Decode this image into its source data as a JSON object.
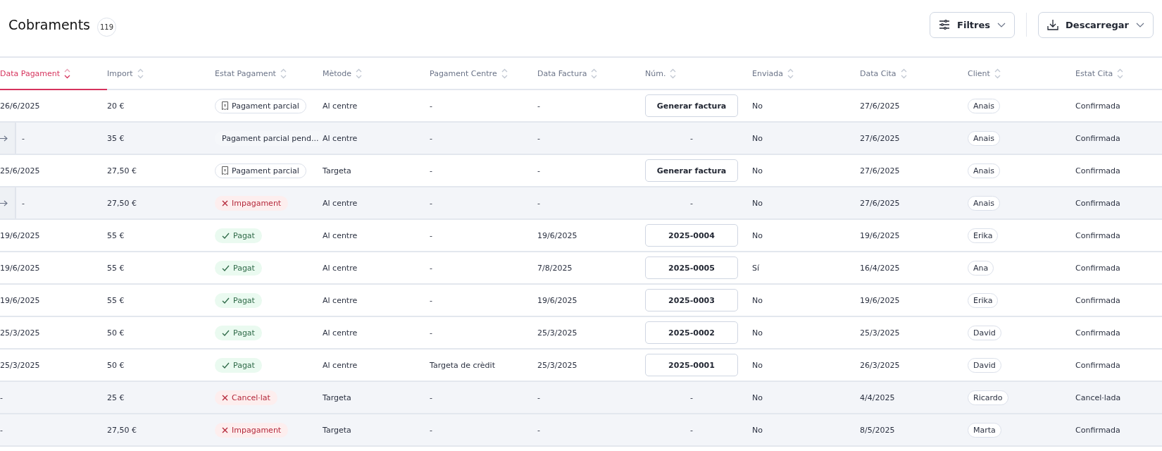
{
  "page": {
    "title": "Cobraments",
    "count": "119"
  },
  "actions": [
    {
      "label": "Filtres",
      "kind": "filter"
    },
    {
      "label": "Descarregar",
      "kind": "download"
    }
  ],
  "table": {
    "columns": [
      {
        "label": "Data Pagament",
        "sorted": true
      },
      {
        "label": "Import",
        "sorted": false
      },
      {
        "label": "Estat Pagament",
        "sorted": false
      },
      {
        "label": "Mètode",
        "sorted": false
      },
      {
        "label": "Pagament Centre",
        "sorted": false
      },
      {
        "label": "Data Factura",
        "sorted": false
      },
      {
        "label": "Núm.",
        "sorted": false
      },
      {
        "label": "Enviada",
        "sorted": false
      },
      {
        "label": "Data Cita",
        "sorted": false
      },
      {
        "label": "Client",
        "sorted": false
      },
      {
        "label": "Estat Cita",
        "sorted": false
      }
    ],
    "rows": [
      {
        "child": false,
        "shaded": false,
        "date": "26/6/2025",
        "amount": "20 €",
        "status": {
          "label": "Pagament parcial",
          "kind": "partial"
        },
        "method": "Al centre",
        "centre": "-",
        "invoice_date": "-",
        "number": {
          "text": "Generar factura",
          "kind": "action"
        },
        "sent": "No",
        "appointment": "27/6/2025",
        "client": "Anais",
        "appointment_status": "Confirmada"
      },
      {
        "child": true,
        "shaded": true,
        "date": "-",
        "amount": "35 €",
        "status": {
          "label": "Pagament parcial pend...",
          "kind": "pending"
        },
        "method": "Al centre",
        "centre": "-",
        "invoice_date": "-",
        "number": {
          "text": "-",
          "kind": "empty"
        },
        "sent": "No",
        "appointment": "27/6/2025",
        "client": "Anais",
        "appointment_status": "Confirmada"
      },
      {
        "child": false,
        "shaded": false,
        "date": "25/6/2025",
        "amount": "27,50 €",
        "status": {
          "label": "Pagament parcial",
          "kind": "partial"
        },
        "method": "Targeta",
        "centre": "-",
        "invoice_date": "-",
        "number": {
          "text": "Generar factura",
          "kind": "action"
        },
        "sent": "No",
        "appointment": "27/6/2025",
        "client": "Anais",
        "appointment_status": "Confirmada"
      },
      {
        "child": true,
        "shaded": true,
        "date": "-",
        "amount": "27,50 €",
        "status": {
          "label": "Impagament",
          "kind": "failed"
        },
        "method": "Al centre",
        "centre": "-",
        "invoice_date": "-",
        "number": {
          "text": "-",
          "kind": "empty"
        },
        "sent": "No",
        "appointment": "27/6/2025",
        "client": "Anais",
        "appointment_status": "Confirmada"
      },
      {
        "child": false,
        "shaded": false,
        "date": "19/6/2025",
        "amount": "55 €",
        "status": {
          "label": "Pagat",
          "kind": "paid"
        },
        "method": "Al centre",
        "centre": "-",
        "invoice_date": "19/6/2025",
        "number": {
          "text": "2025-0004",
          "kind": "invoice"
        },
        "sent": "No",
        "appointment": "19/6/2025",
        "client": "Erika",
        "appointment_status": "Confirmada"
      },
      {
        "child": false,
        "shaded": false,
        "date": "19/6/2025",
        "amount": "55 €",
        "status": {
          "label": "Pagat",
          "kind": "paid"
        },
        "method": "Al centre",
        "centre": "-",
        "invoice_date": "7/8/2025",
        "number": {
          "text": "2025-0005",
          "kind": "invoice"
        },
        "sent": "Sí",
        "appointment": "16/4/2025",
        "client": "Ana",
        "appointment_status": "Confirmada"
      },
      {
        "child": false,
        "shaded": false,
        "date": "19/6/2025",
        "amount": "55 €",
        "status": {
          "label": "Pagat",
          "kind": "paid"
        },
        "method": "Al centre",
        "centre": "-",
        "invoice_date": "19/6/2025",
        "number": {
          "text": "2025-0003",
          "kind": "invoice"
        },
        "sent": "No",
        "appointment": "19/6/2025",
        "client": "Erika",
        "appointment_status": "Confirmada"
      },
      {
        "child": false,
        "shaded": false,
        "date": "25/3/2025",
        "amount": "50 €",
        "status": {
          "label": "Pagat",
          "kind": "paid"
        },
        "method": "Al centre",
        "centre": "-",
        "invoice_date": "25/3/2025",
        "number": {
          "text": "2025-0002",
          "kind": "invoice"
        },
        "sent": "No",
        "appointment": "25/3/2025",
        "client": "David",
        "appointment_status": "Confirmada"
      },
      {
        "child": false,
        "shaded": false,
        "date": "25/3/2025",
        "amount": "50 €",
        "status": {
          "label": "Pagat",
          "kind": "paid"
        },
        "method": "Al centre",
        "centre": "Targeta de crèdit",
        "invoice_date": "25/3/2025",
        "number": {
          "text": "2025-0001",
          "kind": "invoice"
        },
        "sent": "No",
        "appointment": "26/3/2025",
        "client": "David",
        "appointment_status": "Confirmada"
      },
      {
        "child": false,
        "shaded": true,
        "date": "-",
        "amount": "25 €",
        "status": {
          "label": "Cancel·lat",
          "kind": "failed"
        },
        "method": "Targeta",
        "centre": "-",
        "invoice_date": "-",
        "number": {
          "text": "-",
          "kind": "empty"
        },
        "sent": "No",
        "appointment": "4/4/2025",
        "client": "Ricardo",
        "appointment_status": "Cancel·lada"
      },
      {
        "child": false,
        "shaded": true,
        "date": "-",
        "amount": "27,50 €",
        "status": {
          "label": "Impagament",
          "kind": "failed"
        },
        "method": "Targeta",
        "centre": "-",
        "invoice_date": "-",
        "number": {
          "text": "-",
          "kind": "empty"
        },
        "sent": "No",
        "appointment": "8/5/2025",
        "client": "Marta",
        "appointment_status": "Confirmada"
      }
    ]
  }
}
